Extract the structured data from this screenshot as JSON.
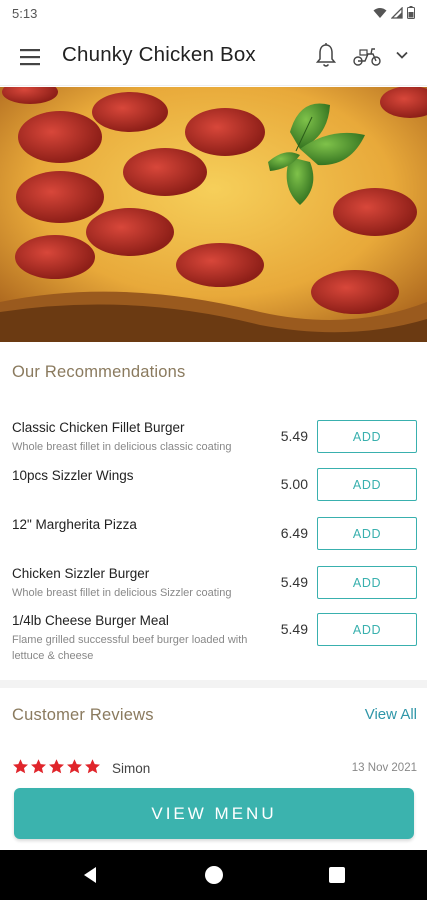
{
  "status_bar": {
    "time": "5:13"
  },
  "app_bar": {
    "title": "Chunky Chicken Box"
  },
  "hero": {
    "icon": "pepperoni-pizza-photo"
  },
  "recommendations": {
    "title": "Our Recommendations",
    "items": [
      {
        "name": "Classic Chicken Fillet Burger",
        "description": "Whole breast fillet in delicious classic coating",
        "price": "5.49",
        "button": "ADD"
      },
      {
        "name": "10pcs Sizzler Wings",
        "description": "",
        "price": "5.00",
        "button": "ADD"
      },
      {
        "name": "12\" Margherita Pizza",
        "description": "",
        "price": "6.49",
        "button": "ADD"
      },
      {
        "name": "Chicken Sizzler Burger",
        "description": "Whole breast fillet in delicious Sizzler coating",
        "price": "5.49",
        "button": "ADD"
      },
      {
        "name": "1/4lb Cheese Burger Meal",
        "description": "Flame grilled successful beef burger loaded with lettuce & cheese",
        "price": "5.49",
        "button": "ADD"
      }
    ]
  },
  "reviews": {
    "title": "Customer Reviews",
    "view_all": "View All",
    "items": [
      {
        "rating": 5,
        "reviewer": "Simon",
        "date": "13 Nov 2021"
      }
    ]
  },
  "view_menu": {
    "label": "VIEW MENU"
  },
  "colors": {
    "accent": "#3bb3ae",
    "link": "#2f96a8",
    "section_title": "#8a7a5e",
    "star": "#e0252b"
  }
}
